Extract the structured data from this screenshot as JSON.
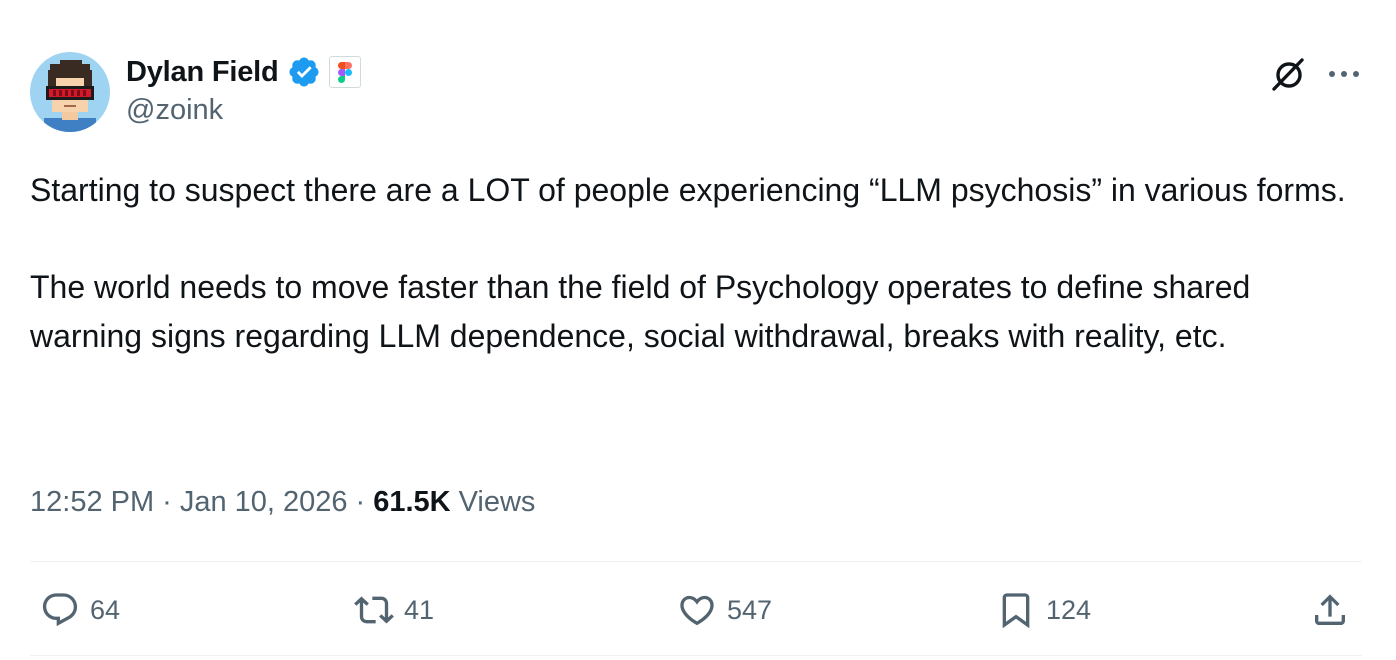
{
  "author": {
    "display_name": "Dylan Field",
    "handle": "@zoink",
    "verified": true,
    "affiliate_badge": "figma-logo-icon",
    "avatar": "pixel-art-avatar-with-red-visor"
  },
  "header_actions": {
    "grok_icon": "grok-icon",
    "more_icon": "more-options-icon"
  },
  "tweet": {
    "paragraphs": [
      "Starting to suspect there are a LOT of people experiencing “LLM psychosis” in various forms.",
      "The world needs to move faster than the field of Psychology operates to define shared warning signs regarding LLM dependence, social withdrawal, breaks with reality, etc."
    ],
    "time": "12:52 PM",
    "separator": "·",
    "date": "Jan 10, 2026",
    "views_count": "61.5K",
    "views_label": "Views"
  },
  "actions": {
    "replies": "64",
    "reposts": "41",
    "likes": "547",
    "bookmarks": "124"
  },
  "colors": {
    "text_primary": "#0f1419",
    "text_secondary": "#536471",
    "verified_blue": "#1d9bf0",
    "divider": "#eff3f4"
  }
}
